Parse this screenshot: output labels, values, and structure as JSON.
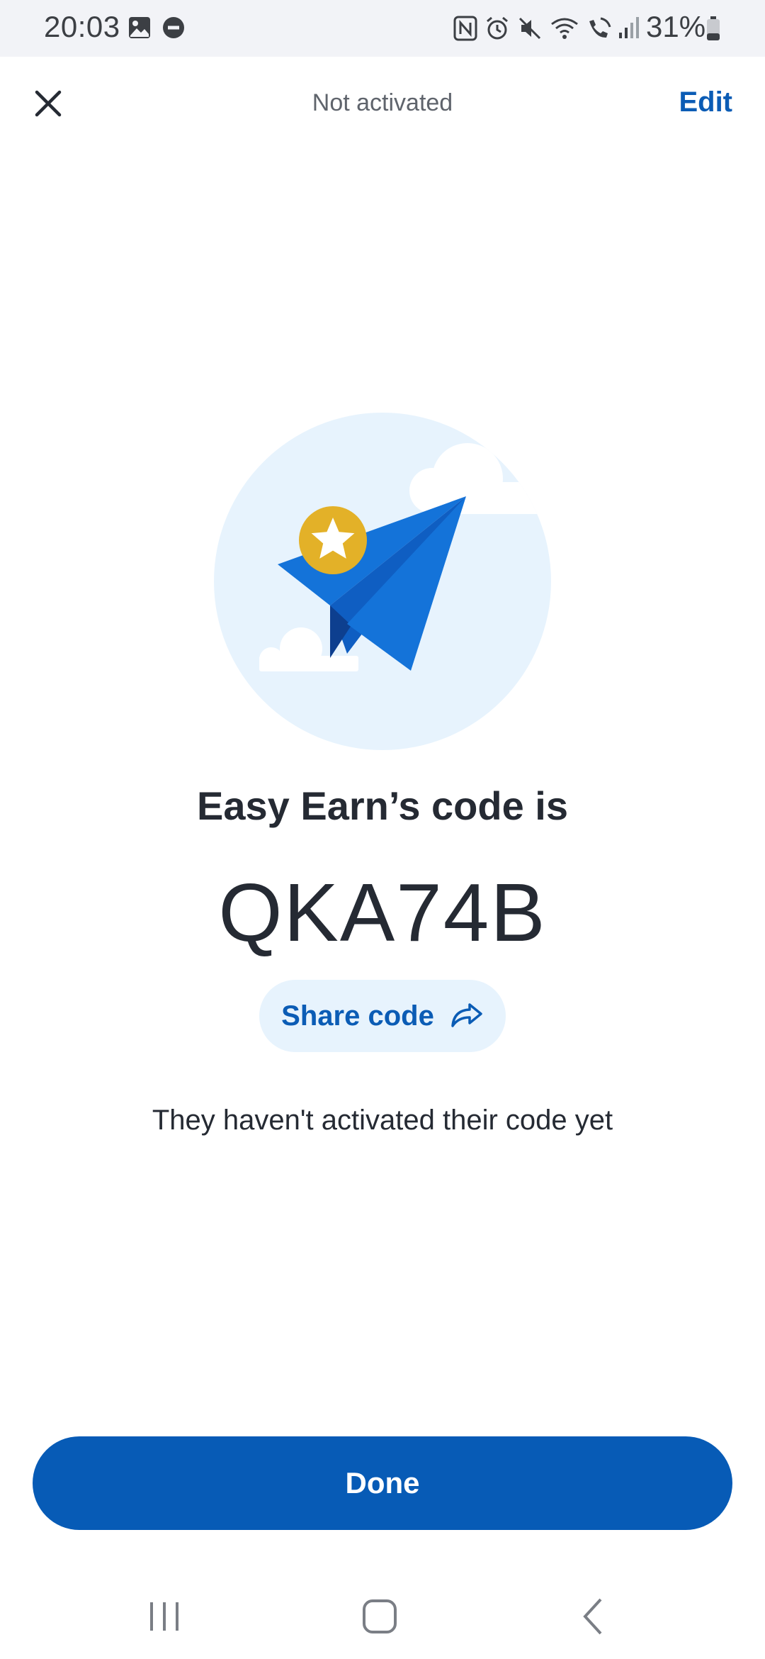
{
  "status_bar": {
    "time": "20:03",
    "battery": "31%",
    "left_icons": [
      "gallery-icon",
      "do-not-disturb-icon"
    ],
    "right_icons": [
      "nfc-icon",
      "alarm-icon",
      "mute-icon",
      "wifi-icon",
      "wifi-calling-icon",
      "signal-icon",
      "battery-icon"
    ]
  },
  "header": {
    "title": "Not activated",
    "edit_label": "Edit",
    "close_icon": "close-icon"
  },
  "illustration": {
    "subject": "paper-plane-with-star",
    "colors": {
      "circle": "#e7f3fd",
      "plane": "#1473d9",
      "plane_dark": "#0d3f8f",
      "badge": "#e3b128",
      "cloud": "#ffffff"
    }
  },
  "main": {
    "heading": "Easy Earn’s code is",
    "code": "QKA74B",
    "share_label": "Share code",
    "status_message": "They haven't activated their code yet"
  },
  "footer": {
    "done_label": "Done"
  },
  "nav": {
    "items": [
      "recent-apps-icon",
      "home-icon",
      "back-icon"
    ]
  },
  "colors": {
    "accent": "#0b5cb5",
    "primary_button": "#075bb6",
    "share_bg": "#e7f3fd",
    "text": "#252a33"
  }
}
